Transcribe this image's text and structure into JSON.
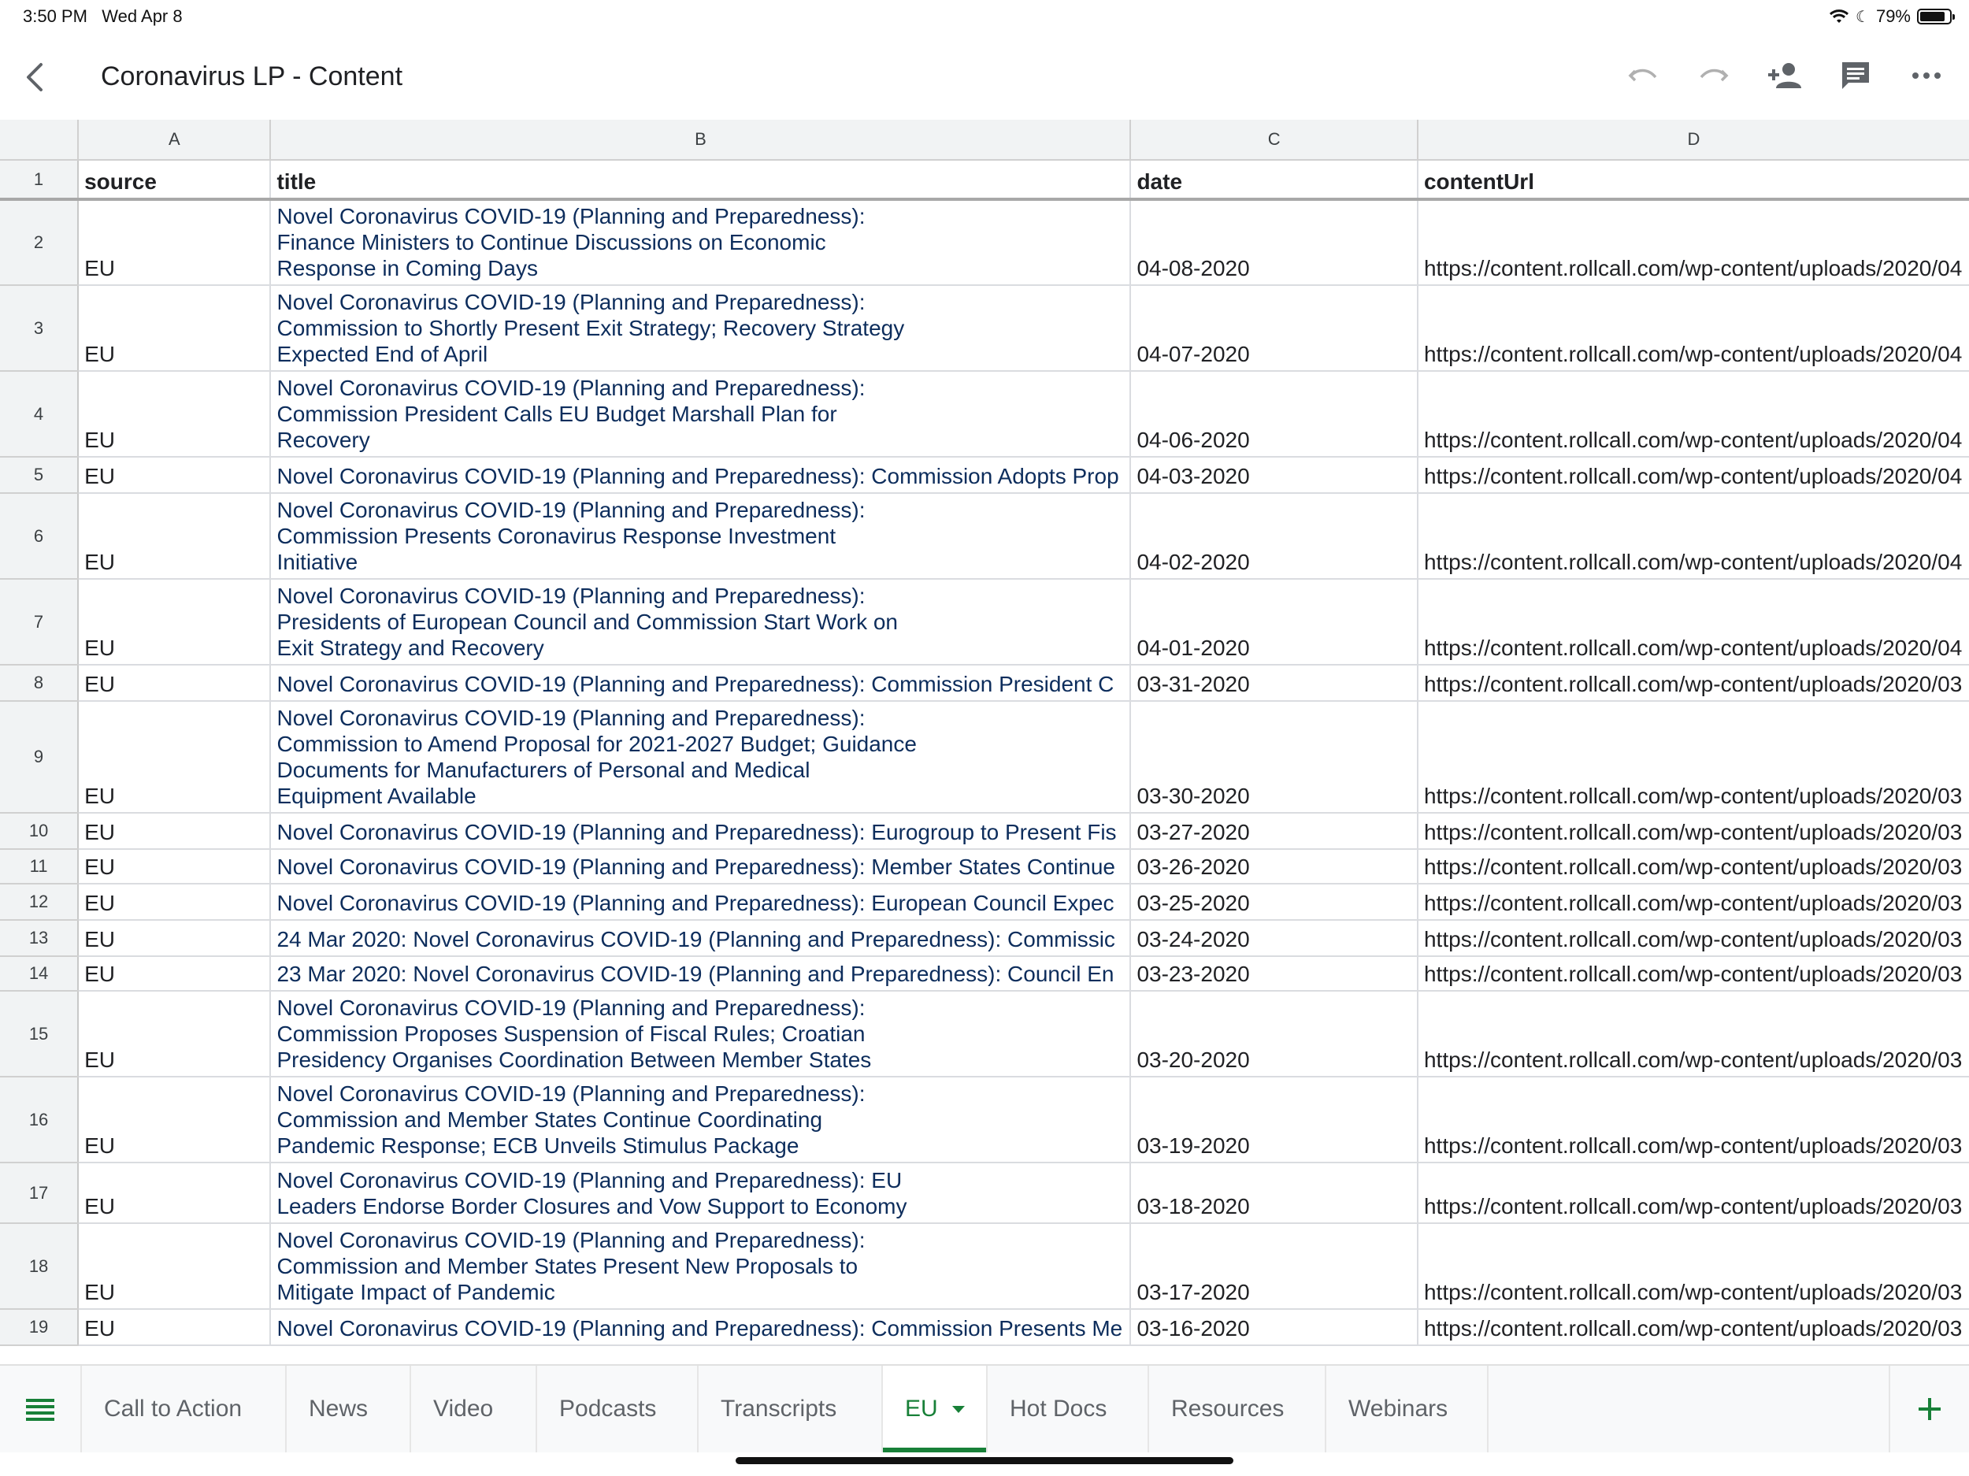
{
  "status": {
    "time": "3:50 PM",
    "date": "Wed Apr 8",
    "battery": "79%"
  },
  "header": {
    "title": "Coronavirus LP - Content",
    "icons": [
      "back-icon",
      "undo-icon",
      "redo-icon",
      "add-person-icon",
      "comment-icon",
      "more-icon"
    ]
  },
  "columns": [
    "A",
    "B",
    "C",
    "D"
  ],
  "header_row": {
    "num": "1",
    "source": "source",
    "title": "title",
    "date": "date",
    "url": "contentUrl"
  },
  "rows": [
    {
      "num": "2",
      "source": "EU",
      "title": "Novel Coronavirus COVID-19 (Planning and Preparedness):\nFinance Ministers to Continue Discussions on Economic\n Response in Coming Days",
      "date": "04-08-2020",
      "url": "https://content.rollcall.com/wp-content/uploads/2020/04"
    },
    {
      "num": "3",
      "source": "EU",
      "title": "Novel Coronavirus COVID-19 (Planning and Preparedness):\n Commission to Shortly Present Exit Strategy; Recovery Strategy\nExpected End of April",
      "date": "04-07-2020",
      "url": "https://content.rollcall.com/wp-content/uploads/2020/04"
    },
    {
      "num": "4",
      "source": "EU",
      "title": "Novel Coronavirus COVID-19 (Planning and Preparedness):\nCommission President Calls EU Budget Marshall Plan for\nRecovery",
      "date": "04-06-2020",
      "url": "https://content.rollcall.com/wp-content/uploads/2020/04"
    },
    {
      "num": "5",
      "source": "EU",
      "title": "Novel Coronavirus COVID-19 (Planning and Preparedness): Commission Adopts Prop",
      "date": "04-03-2020",
      "url": "https://content.rollcall.com/wp-content/uploads/2020/04"
    },
    {
      "num": "6",
      "source": "EU",
      "title": "Novel Coronavirus COVID-19 (Planning and Preparedness):\nCommission Presents Coronavirus Response Investment\nInitiative",
      "date": "04-02-2020",
      "url": "https://content.rollcall.com/wp-content/uploads/2020/04"
    },
    {
      "num": "7",
      "source": "EU",
      "title": "Novel Coronavirus COVID-19 (Planning and Preparedness):\nPresidents of European Council and Commission Start Work on\nExit Strategy and Recovery",
      "date": "04-01-2020",
      "url": "https://content.rollcall.com/wp-content/uploads/2020/04"
    },
    {
      "num": "8",
      "source": "EU",
      "title": "Novel Coronavirus COVID-19 (Planning and Preparedness): Commission President C",
      "date": "03-31-2020",
      "url": "https://content.rollcall.com/wp-content/uploads/2020/03"
    },
    {
      "num": "9",
      "source": "EU",
      "title": "Novel Coronavirus COVID-19 (Planning and Preparedness):\nCommission to Amend Proposal for 2021-2027 Budget; Guidance\nDocuments for Manufacturers of Personal and Medical\nEquipment Available",
      "date": "03-30-2020",
      "url": "https://content.rollcall.com/wp-content/uploads/2020/03"
    },
    {
      "num": "10",
      "source": "EU",
      "title": "Novel Coronavirus COVID-19 (Planning and Preparedness): Eurogroup to Present Fis",
      "date": "03-27-2020",
      "url": "https://content.rollcall.com/wp-content/uploads/2020/03"
    },
    {
      "num": "11",
      "source": "EU",
      "title": "Novel Coronavirus COVID-19 (Planning and Preparedness): Member States Continue",
      "date": "03-26-2020",
      "url": "https://content.rollcall.com/wp-content/uploads/2020/03"
    },
    {
      "num": "12",
      "source": "EU",
      "title": "Novel Coronavirus COVID-19 (Planning and Preparedness): European Council Expec",
      "date": "03-25-2020",
      "url": "https://content.rollcall.com/wp-content/uploads/2020/03"
    },
    {
      "num": "13",
      "source": "EU",
      "title": "24 Mar 2020: Novel Coronavirus COVID-19 (Planning and Preparedness): Commissic",
      "date": "03-24-2020",
      "url": "https://content.rollcall.com/wp-content/uploads/2020/03"
    },
    {
      "num": "14",
      "source": "EU",
      "title": "23 Mar 2020: Novel Coronavirus COVID-19 (Planning and Preparedness): Council En",
      "date": "03-23-2020",
      "url": "https://content.rollcall.com/wp-content/uploads/2020/03"
    },
    {
      "num": "15",
      "source": "EU",
      "title": "Novel Coronavirus COVID-19 (Planning and Preparedness):\nCommission Proposes Suspension of Fiscal Rules; Croatian\nPresidency Organises Coordination Between Member States",
      "date": "03-20-2020",
      "url": "https://content.rollcall.com/wp-content/uploads/2020/03"
    },
    {
      "num": "16",
      "source": "EU",
      "title": "Novel Coronavirus COVID-19 (Planning and Preparedness):\nCommission and Member States Continue Coordinating\n Pandemic Response; ECB Unveils Stimulus Package",
      "date": "03-19-2020",
      "url": "https://content.rollcall.com/wp-content/uploads/2020/03"
    },
    {
      "num": "17",
      "source": "EU",
      "title": "Novel Coronavirus COVID-19 (Planning and Preparedness): EU\nLeaders Endorse Border Closures and Vow Support to Economy",
      "date": "03-18-2020",
      "url": "https://content.rollcall.com/wp-content/uploads/2020/03"
    },
    {
      "num": "18",
      "source": "EU",
      "title": "Novel Coronavirus COVID-19 (Planning and Preparedness):\nCommission and Member States Present New Proposals to\nMitigate Impact of Pandemic",
      "date": "03-17-2020",
      "url": "https://content.rollcall.com/wp-content/uploads/2020/03"
    },
    {
      "num": "19",
      "source": "EU",
      "title": "Novel Coronavirus COVID-19 (Planning and Preparedness): Commission Presents Me",
      "date": "03-16-2020",
      "url": "https://content.rollcall.com/wp-content/uploads/2020/03"
    }
  ],
  "tabs": [
    {
      "label": "Call to Action",
      "active": false
    },
    {
      "label": "News",
      "active": false
    },
    {
      "label": "Video",
      "active": false
    },
    {
      "label": "Podcasts",
      "active": false
    },
    {
      "label": "Transcripts",
      "active": false
    },
    {
      "label": "EU",
      "active": true
    },
    {
      "label": "Hot Docs",
      "active": false
    },
    {
      "label": "Resources",
      "active": false
    },
    {
      "label": "Webinars",
      "active": false
    }
  ],
  "colors": {
    "accent": "#188038",
    "title_text": "#0d2d5c",
    "header_bg": "#f1f3f4"
  }
}
